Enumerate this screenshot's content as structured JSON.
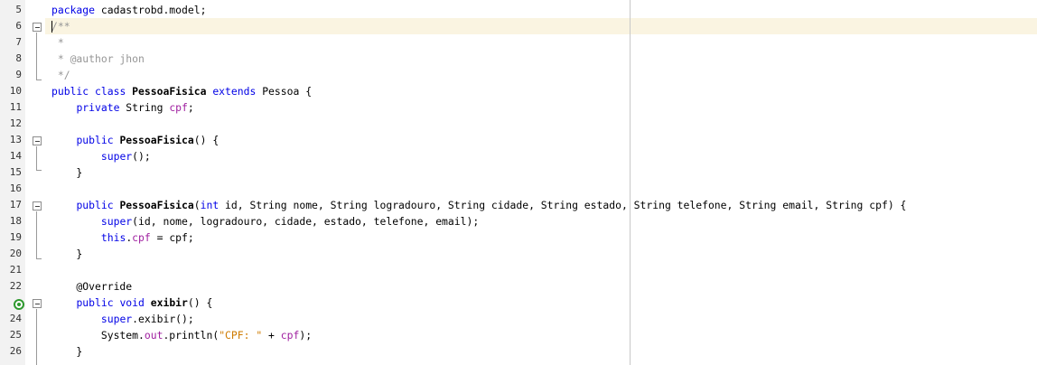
{
  "editor": {
    "lines": [
      {
        "num": "5",
        "tokens": [
          {
            "t": "package",
            "c": "k"
          },
          {
            "t": " cadastrobd.model;"
          }
        ]
      },
      {
        "num": "6",
        "tokens": [
          {
            "t": "/**",
            "c": "c"
          }
        ]
      },
      {
        "num": "7",
        "tokens": [
          {
            "t": " *",
            "c": "c"
          }
        ]
      },
      {
        "num": "8",
        "tokens": [
          {
            "t": " * @author jhon",
            "c": "c"
          }
        ]
      },
      {
        "num": "9",
        "tokens": [
          {
            "t": " */",
            "c": "c"
          }
        ]
      },
      {
        "num": "10",
        "tokens": [
          {
            "t": "public",
            "c": "k"
          },
          {
            "t": " "
          },
          {
            "t": "class",
            "c": "k"
          },
          {
            "t": " "
          },
          {
            "t": "PessoaFisica",
            "c": "b"
          },
          {
            "t": " "
          },
          {
            "t": "extends",
            "c": "k"
          },
          {
            "t": " Pessoa {"
          }
        ]
      },
      {
        "num": "11",
        "tokens": [
          {
            "t": "    "
          },
          {
            "t": "private",
            "c": "k"
          },
          {
            "t": " String "
          },
          {
            "t": "cpf",
            "c": "f"
          },
          {
            "t": ";"
          }
        ]
      },
      {
        "num": "12",
        "tokens": []
      },
      {
        "num": "13",
        "tokens": [
          {
            "t": "    "
          },
          {
            "t": "public",
            "c": "k"
          },
          {
            "t": " "
          },
          {
            "t": "PessoaFisica",
            "c": "b"
          },
          {
            "t": "() {"
          }
        ]
      },
      {
        "num": "14",
        "tokens": [
          {
            "t": "        "
          },
          {
            "t": "super",
            "c": "k"
          },
          {
            "t": "();"
          }
        ]
      },
      {
        "num": "15",
        "tokens": [
          {
            "t": "    }"
          }
        ]
      },
      {
        "num": "16",
        "tokens": []
      },
      {
        "num": "17",
        "tokens": [
          {
            "t": "    "
          },
          {
            "t": "public",
            "c": "k"
          },
          {
            "t": " "
          },
          {
            "t": "PessoaFisica",
            "c": "b"
          },
          {
            "t": "("
          },
          {
            "t": "int",
            "c": "k"
          },
          {
            "t": " id, String nome, String logradouro, String cidade, String estado, String telefone, String email, String cpf) {"
          }
        ]
      },
      {
        "num": "18",
        "tokens": [
          {
            "t": "        "
          },
          {
            "t": "super",
            "c": "k"
          },
          {
            "t": "(id, nome, logradouro, cidade, estado, telefone, email);"
          }
        ]
      },
      {
        "num": "19",
        "tokens": [
          {
            "t": "        "
          },
          {
            "t": "this",
            "c": "k"
          },
          {
            "t": "."
          },
          {
            "t": "cpf",
            "c": "f"
          },
          {
            "t": " = cpf;"
          }
        ]
      },
      {
        "num": "20",
        "tokens": [
          {
            "t": "    }"
          }
        ]
      },
      {
        "num": "21",
        "tokens": []
      },
      {
        "num": "22",
        "tokens": [
          {
            "t": "    @Override"
          }
        ]
      },
      {
        "num": "",
        "tokens": [
          {
            "t": "    "
          },
          {
            "t": "public",
            "c": "k"
          },
          {
            "t": " "
          },
          {
            "t": "void",
            "c": "k"
          },
          {
            "t": " "
          },
          {
            "t": "exibir",
            "c": "b"
          },
          {
            "t": "() {"
          }
        ]
      },
      {
        "num": "24",
        "tokens": [
          {
            "t": "        "
          },
          {
            "t": "super",
            "c": "k"
          },
          {
            "t": ".exibir();"
          }
        ]
      },
      {
        "num": "25",
        "tokens": [
          {
            "t": "        System."
          },
          {
            "t": "out",
            "c": "f"
          },
          {
            "t": ".println("
          },
          {
            "t": "\"CPF: \"",
            "c": "s"
          },
          {
            "t": " + "
          },
          {
            "t": "cpf",
            "c": "f"
          },
          {
            "t": ");"
          }
        ]
      },
      {
        "num": "26",
        "tokens": [
          {
            "t": "    }"
          }
        ]
      }
    ],
    "icons": {
      "fold": "fold-minus-icon",
      "override": "override-method-icon"
    }
  }
}
